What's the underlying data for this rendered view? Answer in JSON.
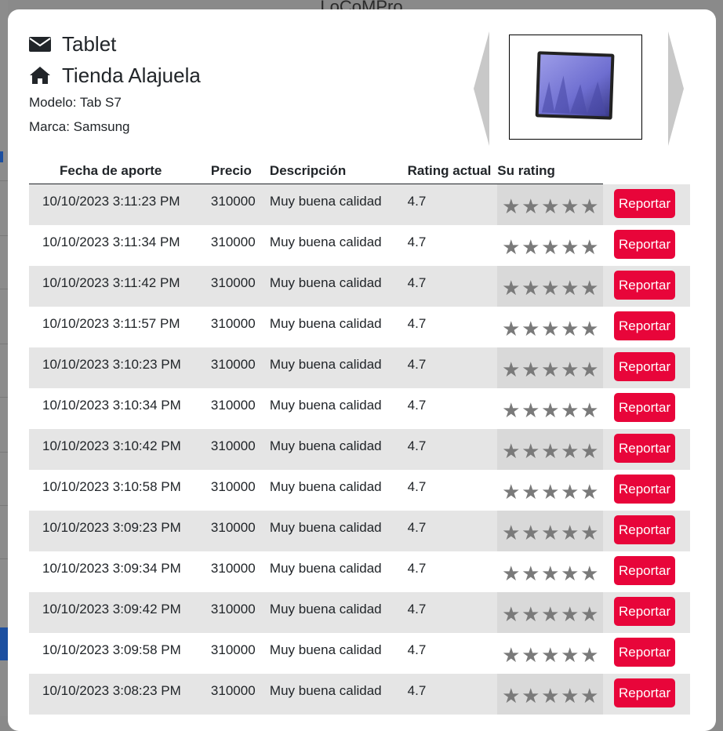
{
  "background": {
    "app_title": "LoCoMPro"
  },
  "header": {
    "product_name": "Tablet",
    "store_name": "Tienda Alajuela",
    "model": "Modelo: Tab S7",
    "brand": "Marca: Samsung"
  },
  "table": {
    "headers": {
      "date": "Fecha de aporte",
      "price": "Precio",
      "description": "Descripción",
      "current_rating": "Rating actual",
      "your_rating": "Su rating"
    },
    "star_glyph": "★",
    "report_label": "Reportar",
    "rows": [
      {
        "date": "10/10/2023 3:11:23 PM",
        "price": "310000",
        "description": "Muy buena calidad",
        "rating": "4.7"
      },
      {
        "date": "10/10/2023 3:11:34 PM",
        "price": "310000",
        "description": "Muy buena calidad",
        "rating": "4.7"
      },
      {
        "date": "10/10/2023 3:11:42 PM",
        "price": "310000",
        "description": "Muy buena calidad",
        "rating": "4.7"
      },
      {
        "date": "10/10/2023 3:11:57 PM",
        "price": "310000",
        "description": "Muy buena calidad",
        "rating": "4.7"
      },
      {
        "date": "10/10/2023 3:10:23 PM",
        "price": "310000",
        "description": "Muy buena calidad",
        "rating": "4.7"
      },
      {
        "date": "10/10/2023 3:10:34 PM",
        "price": "310000",
        "description": "Muy buena calidad",
        "rating": "4.7"
      },
      {
        "date": "10/10/2023 3:10:42 PM",
        "price": "310000",
        "description": "Muy buena calidad",
        "rating": "4.7"
      },
      {
        "date": "10/10/2023 3:10:58 PM",
        "price": "310000",
        "description": "Muy buena calidad",
        "rating": "4.7"
      },
      {
        "date": "10/10/2023 3:09:23 PM",
        "price": "310000",
        "description": "Muy buena calidad",
        "rating": "4.7"
      },
      {
        "date": "10/10/2023 3:09:34 PM",
        "price": "310000",
        "description": "Muy buena calidad",
        "rating": "4.7"
      },
      {
        "date": "10/10/2023 3:09:42 PM",
        "price": "310000",
        "description": "Muy buena calidad",
        "rating": "4.7"
      },
      {
        "date": "10/10/2023 3:09:58 PM",
        "price": "310000",
        "description": "Muy buena calidad",
        "rating": "4.7"
      },
      {
        "date": "10/10/2023 3:08:23 PM",
        "price": "310000",
        "description": "Muy buena calidad",
        "rating": "4.7"
      }
    ]
  },
  "colors": {
    "report_button": "#e8053a",
    "row_alt": "#e5e5e5",
    "star": "#7a7a7a"
  },
  "icons": {
    "product": "envelope-icon",
    "store": "home-icon",
    "prev": "carousel-prev-icon",
    "next": "carousel-next-icon"
  }
}
